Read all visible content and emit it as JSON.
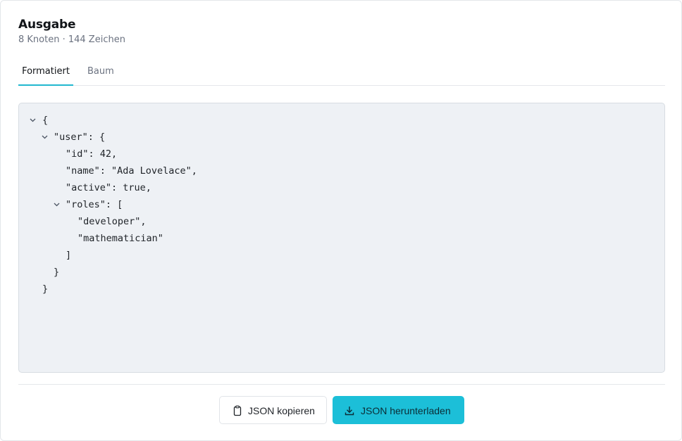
{
  "header": {
    "title": "Ausgabe",
    "subtitle": "8 Knoten · 144 Zeichen"
  },
  "tabs": [
    {
      "label": "Formatiert",
      "active": true
    },
    {
      "label": "Baum",
      "active": false
    }
  ],
  "json_view": {
    "lines": [
      "{",
      "\"user\": {",
      "\"id\": 42,",
      "\"name\": \"Ada Lovelace\",",
      "\"active\": true,",
      "\"roles\": [",
      "\"developer\",",
      "\"mathematician\"",
      "]",
      "}",
      "}"
    ]
  },
  "actions": {
    "copy_label": "JSON kopieren",
    "copy_icon": "clipboard-icon",
    "download_label": "JSON herunterladen",
    "download_icon": "download-icon"
  },
  "colors": {
    "accent": "#22b8cf",
    "primary_button": "#1cbfd8",
    "editor_background": "#eef1f5"
  }
}
